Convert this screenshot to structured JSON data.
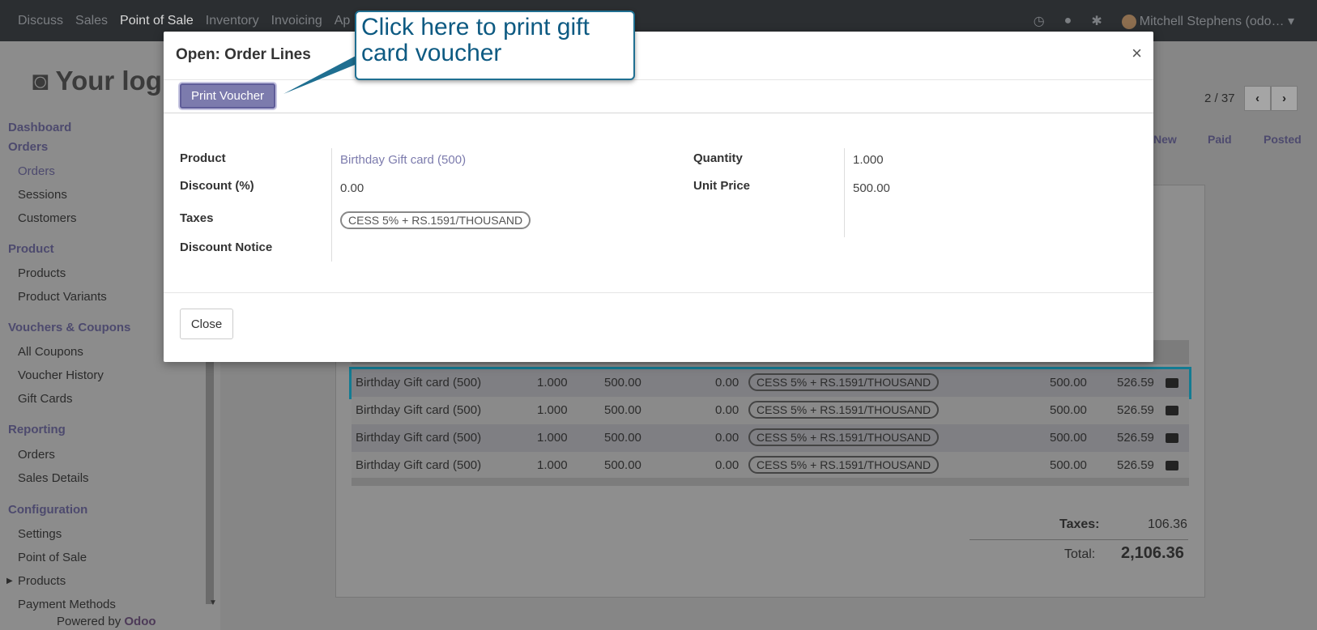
{
  "topbar": {
    "menu": [
      "Discuss",
      "Sales",
      "Point of Sale",
      "Inventory",
      "Invoicing",
      "Ap"
    ],
    "active_index": 2,
    "user": "Mitchell Stephens (odo…"
  },
  "sidebar": {
    "logo_text": "Your log",
    "groups": [
      {
        "head": "Dashboard"
      },
      {
        "head": "Orders",
        "items": [
          "Orders",
          "Sessions",
          "Customers"
        ]
      },
      {
        "head": "Product",
        "items": [
          "Products",
          "Product Variants"
        ]
      },
      {
        "head": "Vouchers & Coupons",
        "items": [
          "All Coupons",
          "Voucher History",
          "Gift Cards"
        ]
      },
      {
        "head": "Reporting",
        "items": [
          "Orders",
          "Sales Details"
        ]
      },
      {
        "head": "Configuration",
        "items": [
          "Settings",
          "Point of Sale",
          "Products",
          "Payment Methods"
        ]
      }
    ],
    "powered_by": "Powered by",
    "powered_brand": "Odoo"
  },
  "record": {
    "pager": "2 / 37",
    "status": [
      "New",
      "Paid",
      "Posted"
    ]
  },
  "order_lines": [
    {
      "product": "Birthday Gift card (500)",
      "qty": "1.000",
      "price": "500.00",
      "disc": "0.00",
      "tax": "CESS 5% + RS.1591/THOUSAND",
      "subtotal": "500.00",
      "total": "526.59"
    },
    {
      "product": "Birthday Gift card (500)",
      "qty": "1.000",
      "price": "500.00",
      "disc": "0.00",
      "tax": "CESS 5% + RS.1591/THOUSAND",
      "subtotal": "500.00",
      "total": "526.59"
    },
    {
      "product": "Birthday Gift card (500)",
      "qty": "1.000",
      "price": "500.00",
      "disc": "0.00",
      "tax": "CESS 5% + RS.1591/THOUSAND",
      "subtotal": "500.00",
      "total": "526.59"
    },
    {
      "product": "Birthday Gift card (500)",
      "qty": "1.000",
      "price": "500.00",
      "disc": "0.00",
      "tax": "CESS 5% + RS.1591/THOUSAND",
      "subtotal": "500.00",
      "total": "526.59"
    }
  ],
  "totals": {
    "taxes_label": "Taxes:",
    "taxes_value": "106.36",
    "total_label": "Total:",
    "total_value": "2,106.36"
  },
  "modal": {
    "title": "Open: Order Lines",
    "close_icon": "×",
    "print_button": "Print Voucher",
    "fields": {
      "product_label": "Product",
      "product_value": "Birthday Gift card (500)",
      "discount_label": "Discount (%)",
      "discount_value": "0.00",
      "taxes_label": "Taxes",
      "taxes_value": "CESS 5% + RS.1591/THOUSAND",
      "discount_notice_label": "Discount Notice",
      "quantity_label": "Quantity",
      "quantity_value": "1.000",
      "unit_price_label": "Unit Price",
      "unit_price_value": "500.00"
    },
    "close_button": "Close"
  },
  "tooltip": {
    "text": "Click here to print gift card voucher"
  }
}
